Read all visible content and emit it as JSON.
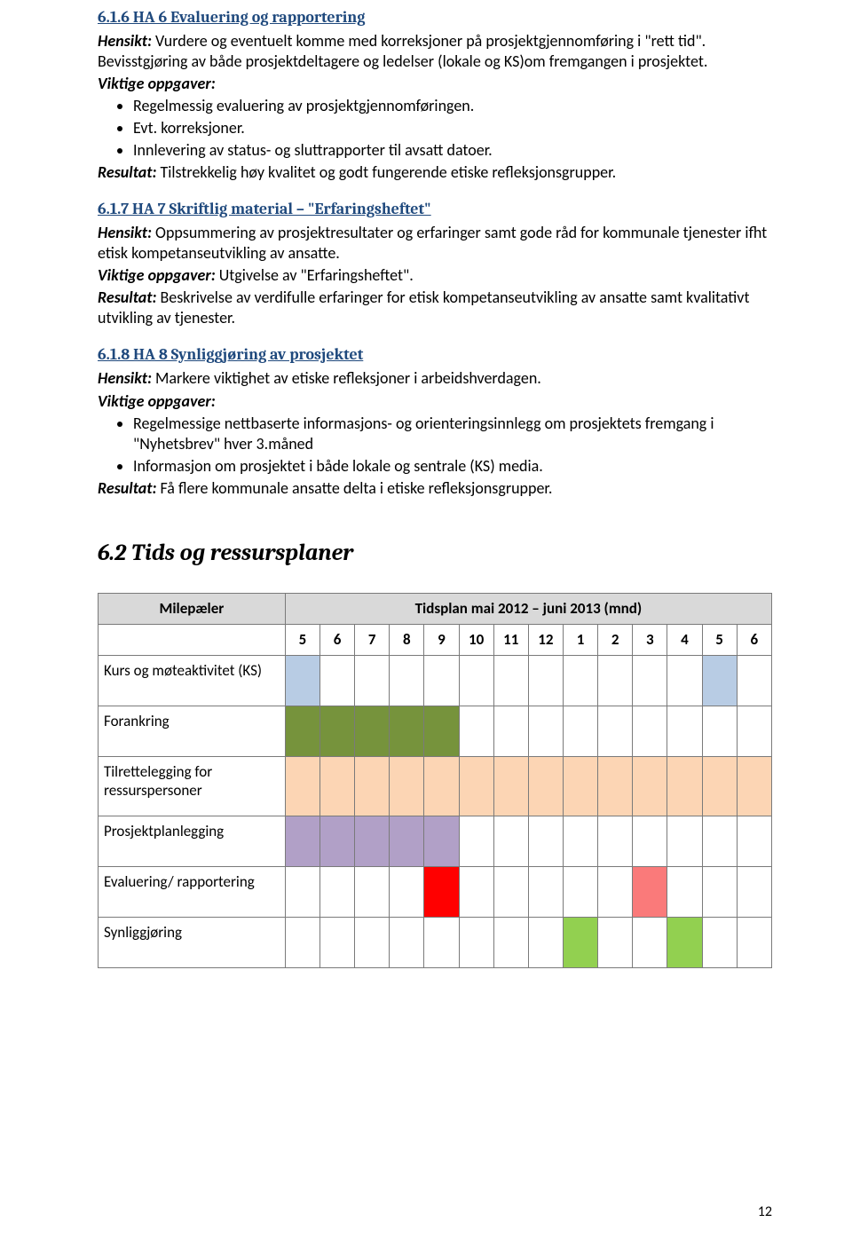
{
  "sec616": {
    "heading": "6.1.6 HA 6 Evaluering og rapportering",
    "hensikt_label": "Hensikt:",
    "hensikt": " Vurdere og eventuelt komme med korreksjoner på prosjektgjennomføring i \"rett tid\". Bevisstgjøring av både prosjektdeltagere og ledelser (lokale og KS)om fremgangen i prosjektet.",
    "viktige_label": "Viktige oppgaver:",
    "bullets": [
      "Regelmessig evaluering av prosjektgjennomføringen.",
      "Evt. korreksjoner.",
      "Innlevering av status- og sluttrapporter til avsatt datoer."
    ],
    "resultat_label": "Resultat:",
    "resultat": " Tilstrekkelig høy kvalitet og godt fungerende etiske refleksjonsgrupper."
  },
  "sec617": {
    "heading": "6.1.7 HA 7 Skriftlig material – \"Erfaringsheftet\"",
    "hensikt_label": "Hensikt:",
    "hensikt": " Oppsummering av prosjektresultater og erfaringer samt gode råd for kommunale tjenester ifht etisk kompetanseutvikling av ansatte.",
    "viktige_label": "Viktige oppgaver:",
    "viktige_text": " Utgivelse av \"Erfaringsheftet\".",
    "resultat_label": "Resultat:",
    "resultat": " Beskrivelse av verdifulle erfaringer for etisk kompetanseutvikling av ansatte samt kvalitativt utvikling av tjenester."
  },
  "sec618": {
    "heading": "6.1.8 HA 8 Synliggjøring av prosjektet",
    "hensikt_label": "Hensikt:",
    "hensikt": " Markere viktighet av etiske refleksjoner i arbeidshverdagen.",
    "viktige_label": "Viktige oppgaver:",
    "bullets": [
      "Regelmessige nettbaserte informasjons- og orienteringsinnlegg om prosjektets fremgang i \"Nyhetsbrev\" hver 3.måned",
      "Informasjon om prosjektet i både lokale og sentrale (KS) media."
    ],
    "resultat_label": "Resultat:",
    "resultat": " Få flere kommunale ansatte delta i etiske refleksjonsgrupper."
  },
  "sec62_heading": "6.2 Tids og ressursplaner",
  "table": {
    "col1_header": "Milepæler",
    "col2_header": "Tidsplan mai 2012 – juni 2013 (mnd)",
    "months": [
      "5",
      "6",
      "7",
      "8",
      "9",
      "10",
      "11",
      "12",
      "1",
      "2",
      "3",
      "4",
      "5",
      "6"
    ],
    "rows": [
      {
        "label": "Kurs og møteaktivitet (KS)",
        "cells": [
          "c-blue",
          "",
          "",
          "",
          "",
          "",
          "",
          "",
          "",
          "",
          "",
          "",
          "c-blue",
          ""
        ]
      },
      {
        "label": "Forankring",
        "cells": [
          "c-green",
          "c-green",
          "c-green",
          "c-green",
          "c-green",
          "",
          "",
          "",
          "",
          "",
          "",
          "",
          "",
          ""
        ]
      },
      {
        "label": "Tilrettelegging for ressurspersoner",
        "tall": true,
        "cells": [
          "c-orange",
          "c-orange",
          "c-orange",
          "c-orange",
          "c-orange",
          "c-orange",
          "c-orange",
          "c-orange",
          "c-orange",
          "c-orange",
          "c-orange",
          "c-orange",
          "c-orange",
          "c-orange"
        ]
      },
      {
        "label": "Prosjektplanlegging",
        "cells": [
          "c-purple",
          "c-purple",
          "c-purple",
          "c-purple",
          "c-purple",
          "",
          "",
          "",
          "",
          "",
          "",
          "",
          "",
          ""
        ]
      },
      {
        "label": "Evaluering/ rapportering",
        "cells": [
          "",
          "",
          "",
          "",
          "c-red",
          "",
          "",
          "",
          "",
          "",
          "c-pink",
          "",
          "",
          ""
        ]
      },
      {
        "label": "Synliggjøring",
        "cells": [
          "",
          "",
          "",
          "",
          "",
          "",
          "",
          "",
          "c-lgreen",
          "",
          "",
          "c-lgreen",
          "",
          ""
        ]
      }
    ]
  },
  "page_number": "12"
}
